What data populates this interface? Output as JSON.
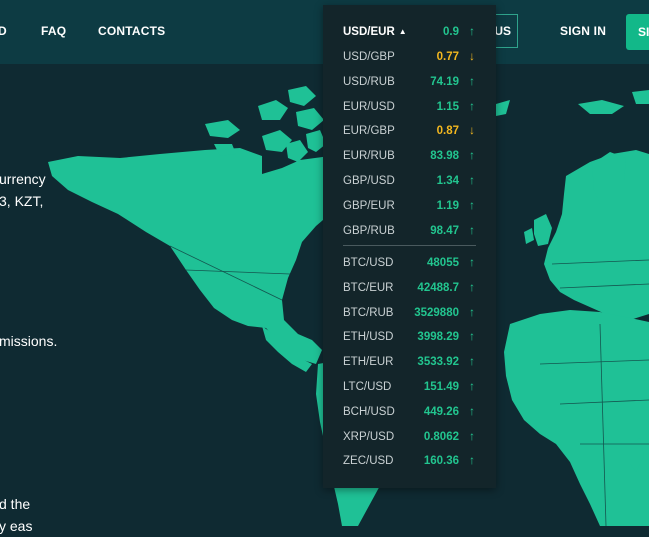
{
  "nav": {
    "partial_item": "D",
    "faq": "FAQ",
    "contacts": "CONTACTS",
    "language": "RUS",
    "sign_in": "SIGN IN",
    "sign_up": "SI"
  },
  "hero": {
    "line1": "urrency",
    "line2": "3, KZT,",
    "line3": "missions.",
    "line4": "d the",
    "line5": "y eas"
  },
  "rates": {
    "selected": {
      "pair": "USD/EUR",
      "value": "0.9",
      "trend": "↑"
    },
    "fiat": [
      {
        "pair": "USD/GBP",
        "value": "0.77",
        "trend": "↓"
      },
      {
        "pair": "USD/RUB",
        "value": "74.19",
        "trend": "↑"
      },
      {
        "pair": "EUR/USD",
        "value": "1.15",
        "trend": "↑"
      },
      {
        "pair": "EUR/GBP",
        "value": "0.87",
        "trend": "↓"
      },
      {
        "pair": "EUR/RUB",
        "value": "83.98",
        "trend": "↑"
      },
      {
        "pair": "GBP/USD",
        "value": "1.34",
        "trend": "↑"
      },
      {
        "pair": "GBP/EUR",
        "value": "1.19",
        "trend": "↑"
      },
      {
        "pair": "GBP/RUB",
        "value": "98.47",
        "trend": "↑"
      }
    ],
    "crypto": [
      {
        "pair": "BTC/USD",
        "value": "48055",
        "trend": "↑"
      },
      {
        "pair": "BTC/EUR",
        "value": "42488.7",
        "trend": "↑"
      },
      {
        "pair": "BTC/RUB",
        "value": "3529880",
        "trend": "↑"
      },
      {
        "pair": "ETH/USD",
        "value": "3998.29",
        "trend": "↑"
      },
      {
        "pair": "ETH/EUR",
        "value": "3533.92",
        "trend": "↑"
      },
      {
        "pair": "LTC/USD",
        "value": "151.49",
        "trend": "↑"
      },
      {
        "pair": "BCH/USD",
        "value": "449.26",
        "trend": "↑"
      },
      {
        "pair": "XRP/USD",
        "value": "0.8062",
        "trend": "↑"
      },
      {
        "pair": "ZEC/USD",
        "value": "160.36",
        "trend": "↑"
      }
    ]
  },
  "colors": {
    "background": "#0f2a32",
    "header": "#0d3b43",
    "map": "#1fc196",
    "dropdown": "#13252a",
    "up": "#22c58f",
    "down": "#f4b81f",
    "accent": "#12b889"
  }
}
